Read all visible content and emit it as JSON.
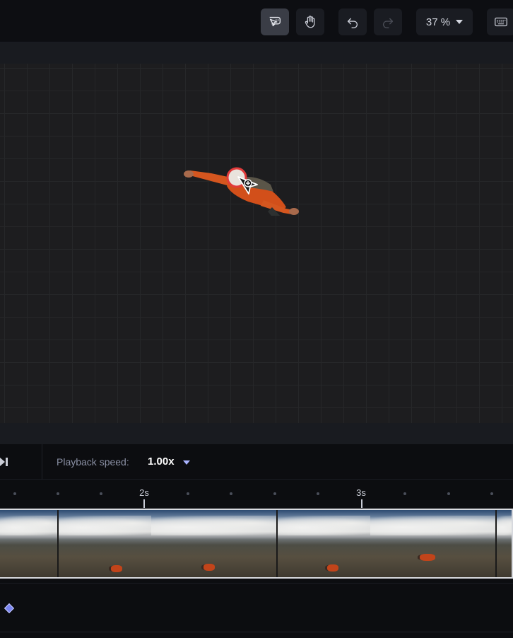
{
  "toolbar": {
    "tools": [
      {
        "name": "select-tool",
        "icon": "pointer-speech-icon",
        "active": true
      },
      {
        "name": "pan-tool",
        "icon": "hand-icon",
        "active": false
      },
      {
        "name": "undo",
        "icon": "undo-icon",
        "active": false
      },
      {
        "name": "redo",
        "icon": "redo-icon",
        "active": false
      }
    ],
    "zoom_value": "37 %",
    "keyboard_icon": "keyboard-icon"
  },
  "canvas": {
    "subject": "skydiver-cutout",
    "cursor_icon": "add-point-cursor-icon"
  },
  "playback": {
    "end_icon": "skip-to-end-icon",
    "speed_label": "Playback speed:",
    "speed_value": "1.00x"
  },
  "ruler": {
    "ticks": [
      "2s",
      "3s"
    ]
  },
  "timeline": {
    "frame_count": 6,
    "keyframe_icon": "keyframe-diamond-icon"
  },
  "colors": {
    "accent": "#7a85f0",
    "background": "#0c0d10",
    "canvas": "#1d1d1f"
  }
}
